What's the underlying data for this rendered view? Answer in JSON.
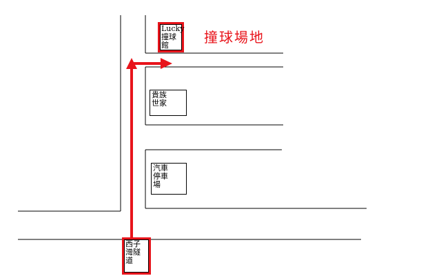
{
  "title": "撞球場地",
  "places": {
    "lucky": "Lucky\n撞球\n館",
    "noble": "貴族\n世家",
    "parking": "汽車\n停車\n場",
    "xiziwan": "西子\n灣隧\n道"
  },
  "colors": {
    "route": "#e8141b",
    "road": "#000000",
    "background": "#ffffff"
  }
}
